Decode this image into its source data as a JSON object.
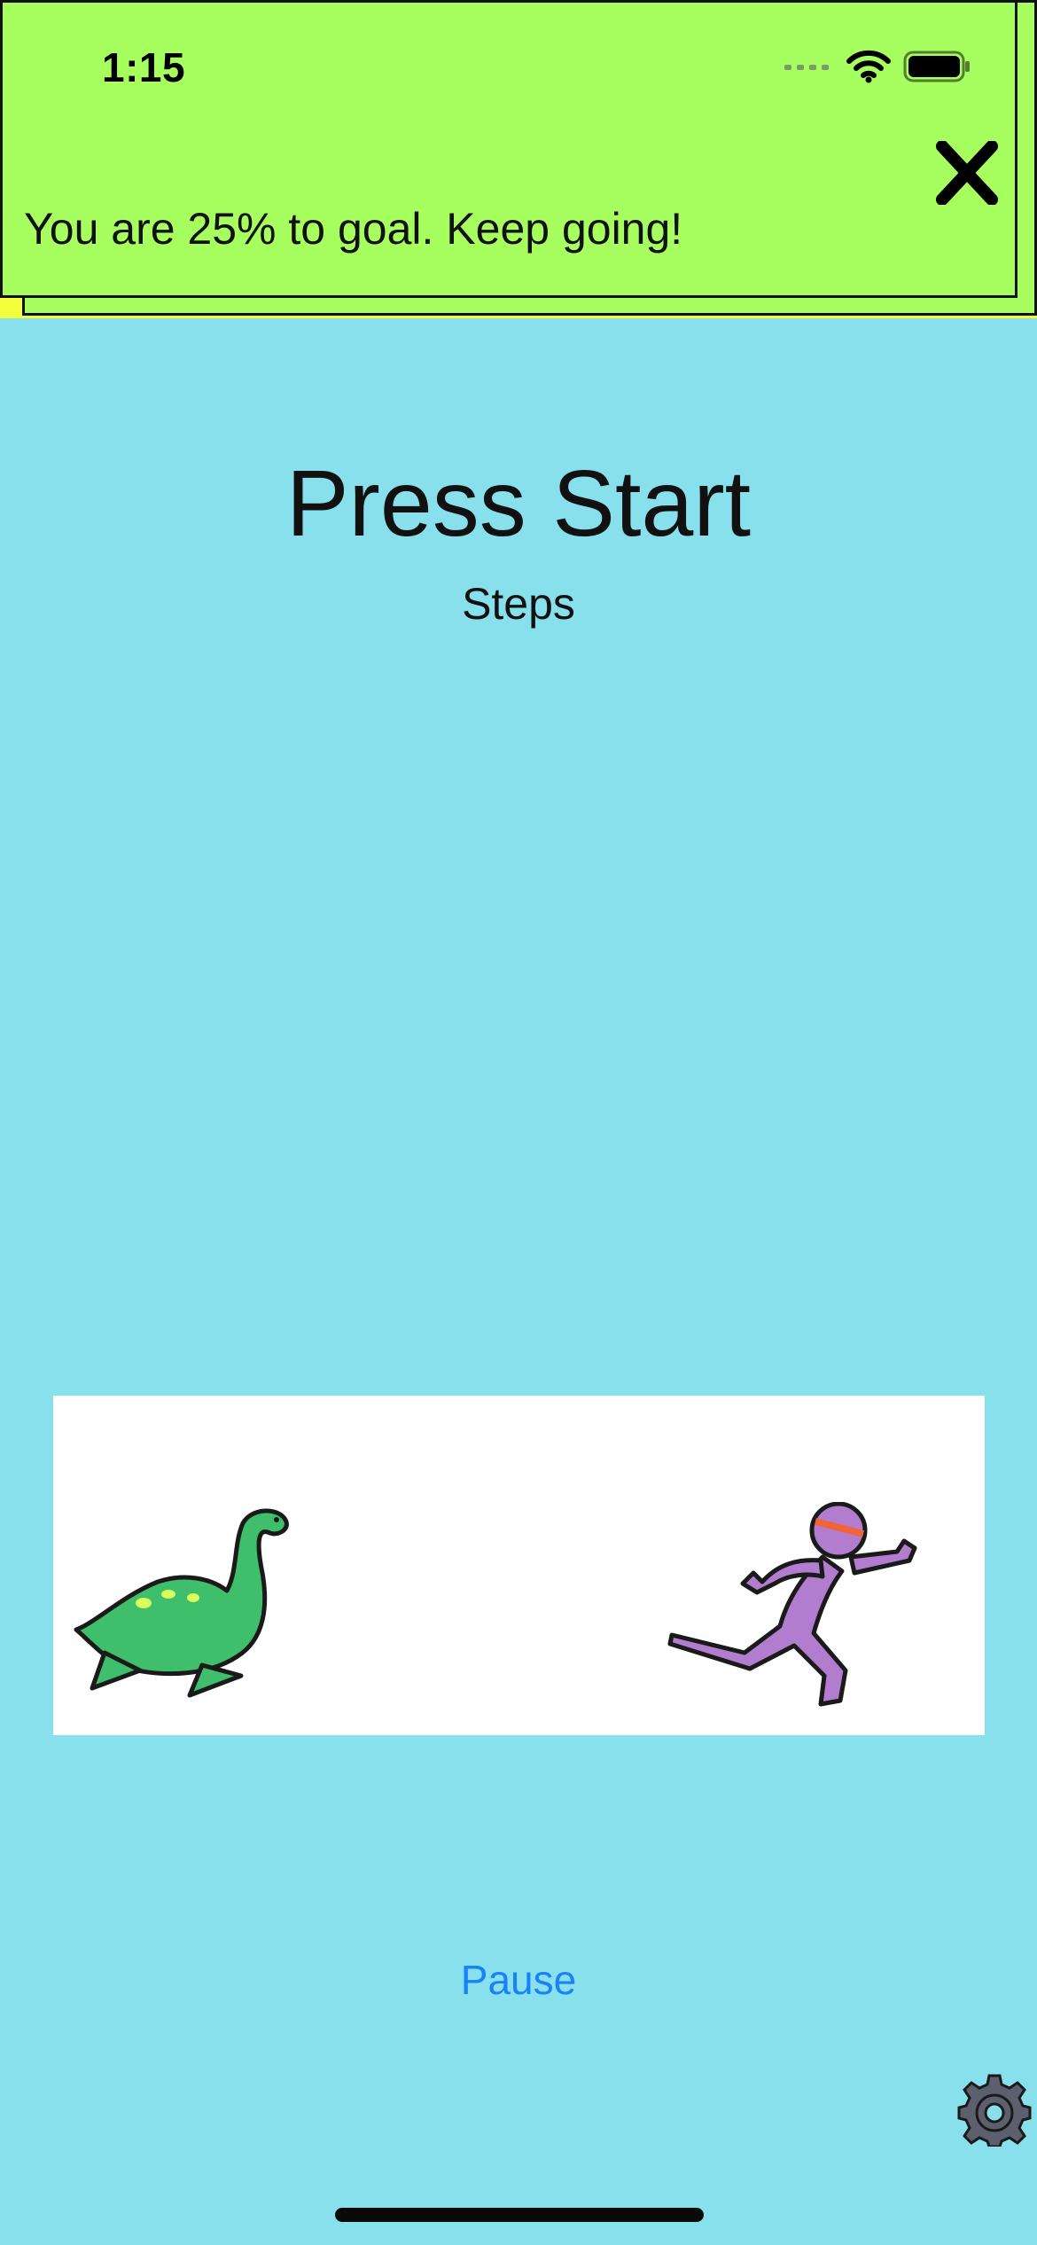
{
  "status_bar": {
    "time": "1:15",
    "icons": [
      "signal-icon",
      "wifi-icon",
      "battery-icon"
    ]
  },
  "notification": {
    "message": "You are 25% to goal. Keep going!",
    "close_icon": "close-icon",
    "background_color": "#a6ff5e"
  },
  "main": {
    "title": "Press Start",
    "subtitle": "Steps"
  },
  "race": {
    "chaser": "sea-monster-illustration",
    "runner": "running-person-illustration"
  },
  "controls": {
    "pause_label": "Pause",
    "settings_icon": "gear-icon"
  },
  "colors": {
    "background": "#87e0eb",
    "accent": "#1a82f7"
  }
}
